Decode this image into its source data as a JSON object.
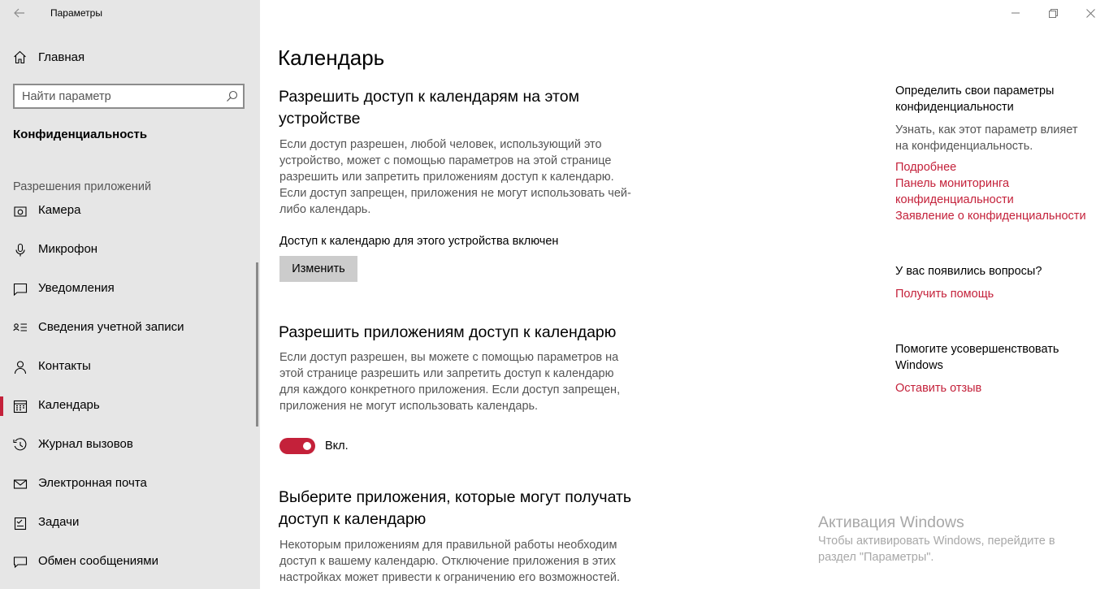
{
  "window": {
    "title": "Параметры",
    "controls": [
      "minimize-icon",
      "restore-icon",
      "close-icon"
    ]
  },
  "sidebar": {
    "home_label": "Главная",
    "search_placeholder": "Найти параметр",
    "section_title": "Конфиденциальность",
    "group_label": "Разрешения приложений",
    "items": [
      {
        "label": "Камера",
        "icon": "camera-icon"
      },
      {
        "label": "Микрофон",
        "icon": "microphone-icon"
      },
      {
        "label": "Уведомления",
        "icon": "notifications-icon"
      },
      {
        "label": "Сведения учетной записи",
        "icon": "account-info-icon"
      },
      {
        "label": "Контакты",
        "icon": "contacts-icon"
      },
      {
        "label": "Календарь",
        "icon": "calendar-icon",
        "active": true
      },
      {
        "label": "Журнал вызовов",
        "icon": "call-history-icon"
      },
      {
        "label": "Электронная почта",
        "icon": "email-icon"
      },
      {
        "label": "Задачи",
        "icon": "tasks-icon"
      },
      {
        "label": "Обмен сообщениями",
        "icon": "messaging-icon"
      }
    ]
  },
  "main": {
    "title": "Календарь",
    "device_access": {
      "heading_line1": "Разрешить доступ к календарям на этом",
      "heading_line2": "устройстве",
      "desc_lines": [
        "Если доступ разрешен, любой человек, использующий это",
        "устройство, может с помощью параметров на этой странице",
        "разрешить или запретить приложениям доступ к календарю.",
        "Если доступ запрещен, приложения не могут использовать чей-",
        "либо календарь."
      ],
      "status": "Доступ к календарю для этого устройства включен",
      "button_label": "Изменить"
    },
    "app_access": {
      "heading": "Разрешить приложениям доступ к календарю",
      "desc_lines": [
        "Если доступ разрешен, вы можете с помощью параметров на",
        "этой странице разрешить или запретить доступ к календарю",
        "для каждого конкретного приложения. Если доступ запрещен,",
        "приложения не могут использовать календарь."
      ],
      "toggle_state": "on",
      "toggle_label": "Вкл."
    },
    "choose_apps": {
      "heading_line1": "Выберите приложения, которые могут получать",
      "heading_line2": "доступ к календарю",
      "desc_lines": [
        "Некоторым приложениям для правильной работы необходим",
        "доступ к вашему календарю. Отключение приложения в этих",
        "настройках может привести к ограничению его возможностей."
      ]
    }
  },
  "right": {
    "privacy_heading_lines": [
      "Определить свои параметры",
      "конфиденциальности"
    ],
    "privacy_desc_lines": [
      "Узнать, как этот параметр влияет",
      "на конфиденциальность."
    ],
    "links": {
      "more": "Подробнее",
      "dashboard_line1": "Панель мониторинга",
      "dashboard_line2": "конфиденциальности",
      "statement": "Заявление о конфиденциальности"
    },
    "questions_heading": "У вас появились вопросы?",
    "get_help": "Получить помощь",
    "improve_lines": [
      "Помогите усовершенствовать",
      "Windows"
    ],
    "feedback": "Оставить отзыв"
  },
  "watermark": {
    "title": "Активация Windows",
    "line1": "Чтобы активировать Windows, перейдите в",
    "line2": "раздел \"Параметры\"."
  },
  "colors": {
    "accent": "#c4213a",
    "sidebar_bg": "#e6e6e6",
    "secondary_text": "#555555"
  }
}
